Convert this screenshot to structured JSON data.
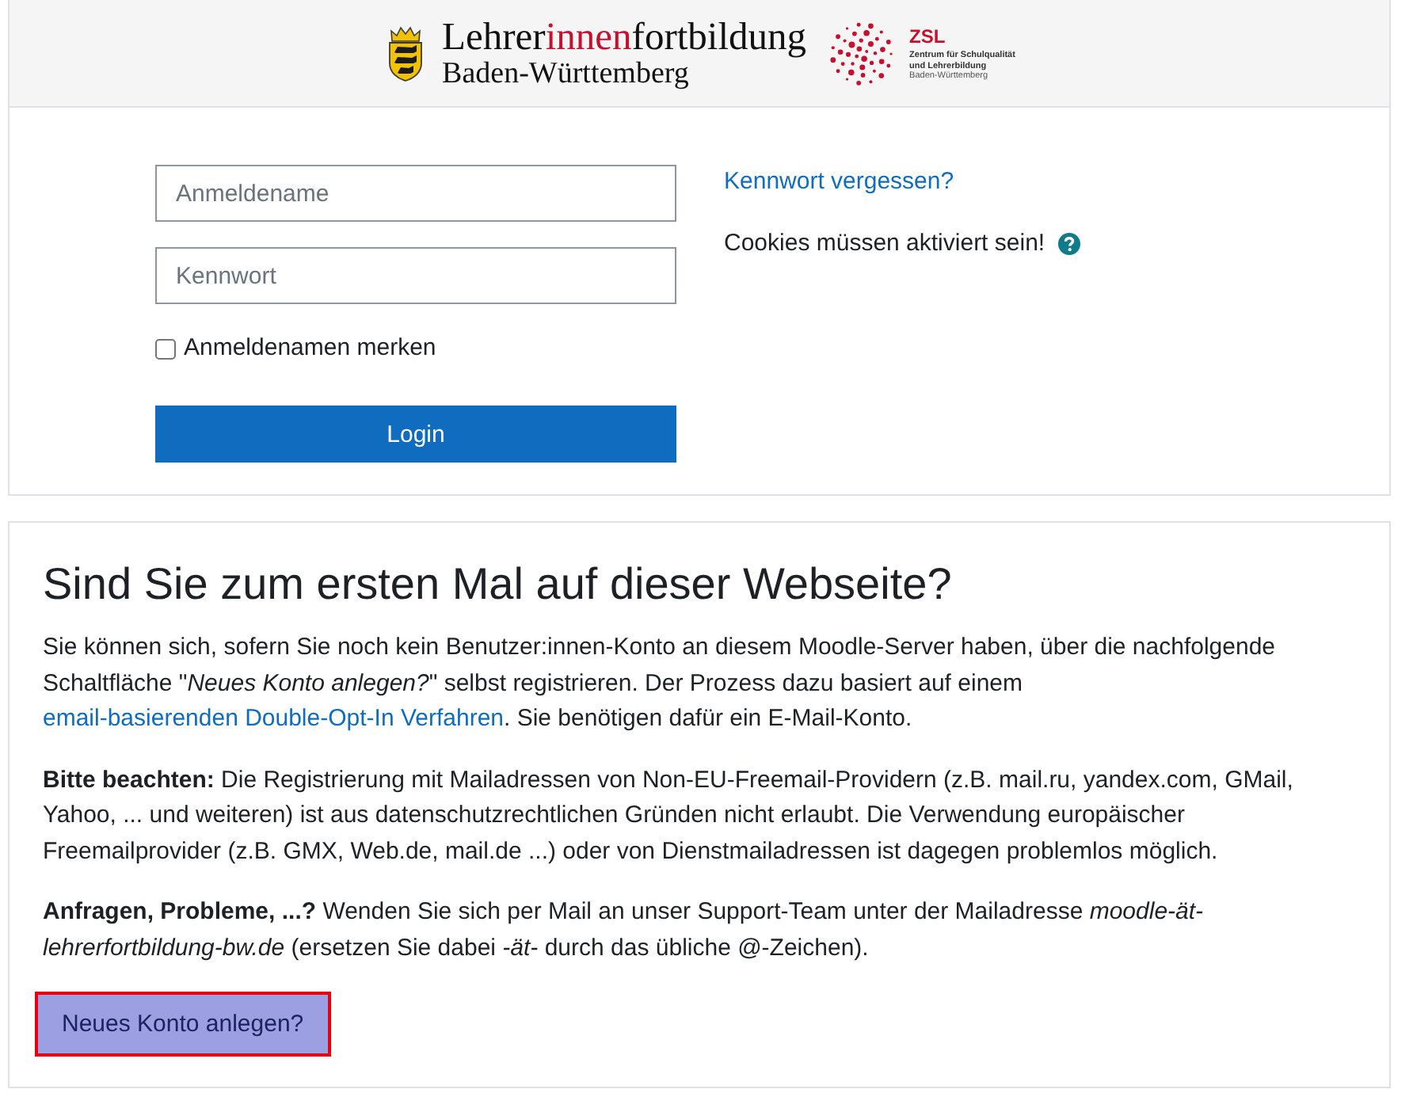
{
  "header": {
    "logo": {
      "title_parts": [
        {
          "text": "Lehrer",
          "accent": false
        },
        {
          "text": "innen",
          "accent": true
        },
        {
          "text": "fortbildung",
          "accent": false
        }
      ],
      "subtitle": "Baden-Württemberg"
    },
    "partner_logo": {
      "acronym": "ZSL",
      "lines": [
        "Zentrum für Schulqualität",
        "und Lehrerbildung",
        "Baden-Württemberg"
      ]
    }
  },
  "login": {
    "fields": [
      {
        "placeholder": "Anmeldename"
      },
      {
        "placeholder": "Kennwort"
      }
    ],
    "remember": {
      "label": "Anmeldenamen merken",
      "checked": false
    },
    "button": "Login",
    "forgot_link": "Kennwort vergessen?",
    "cookies_notice": "Cookies müssen aktiviert sein!"
  },
  "signup": {
    "title": "Sind Sie zum ersten Mal auf dieser Webseite?",
    "paragraphs": [
      [
        {
          "kind": "text",
          "text": "Sie können sich, sofern Sie noch kein Benutzer:innen-Konto an diesem Moodle-Server haben, über die nachfolgende Schaltfläche \"*Neues Konto anlegen?*\" selbst registrieren. Der Prozess dazu basiert auf einem "
        },
        {
          "kind": "link",
          "text": "email-basierenden Double-Opt-In Verfahren"
        },
        {
          "kind": "text",
          "text": ". Sie benötigen dafür ein E-Mail-Konto."
        }
      ],
      [
        {
          "kind": "text",
          "text": "**Bitte beachten:** Die Registrierung mit Mailadressen von Non-EU-Freemail-Providern (z.B. mail.ru, yandex.com, GMail, Yahoo, ... und weiteren) ist aus datenschutzrechtlichen Gründen nicht erlaubt. Die Verwendung europäischer Freemailprovider (z.B. GMX, Web.de, mail.de ...) oder von Dienstmailadressen ist dagegen problemlos möglich."
        }
      ],
      [
        {
          "kind": "text",
          "text": "**Anfragen, Probleme, ...?** Wenden Sie sich per Mail an unser Support-Team unter der Mailadresse *moodle-ät-lehrerfortbildung-bw.de* (ersetzen Sie dabei *-ät-* durch das übliche @-Zeichen)."
        }
      ]
    ],
    "button": "Neues Konto anlegen?"
  }
}
